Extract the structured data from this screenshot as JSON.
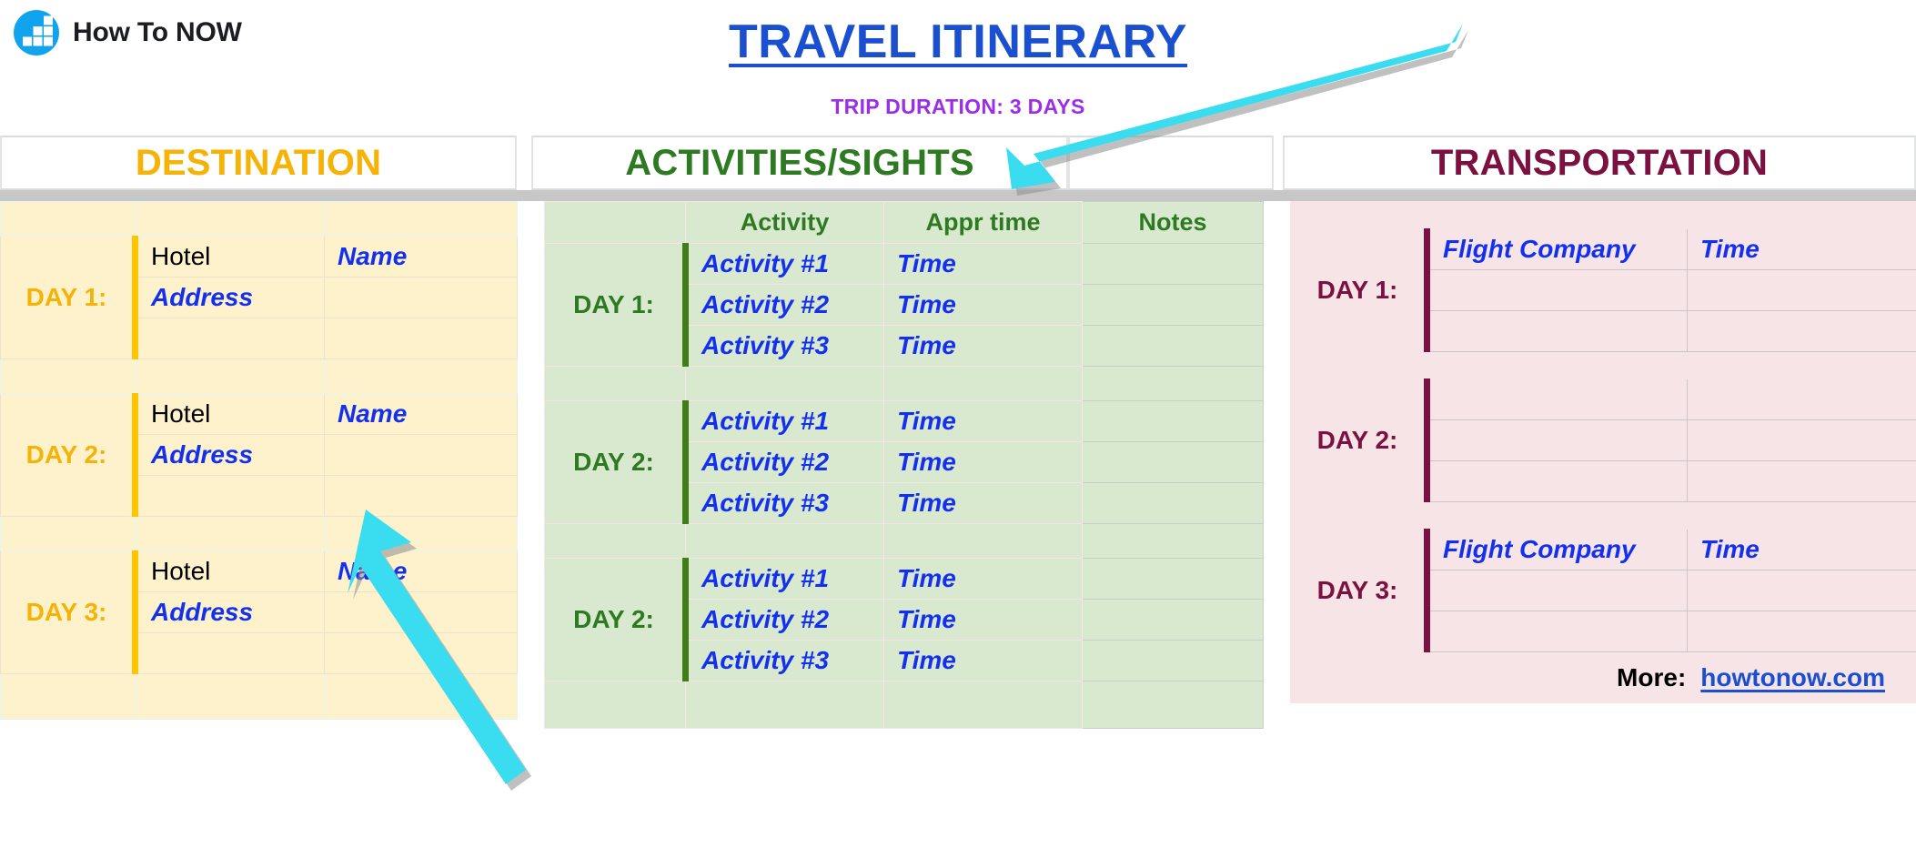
{
  "brand": {
    "name": "How To NOW",
    "logo_icon": "bar-chart-logo-icon",
    "logo_color": "#12a3ef"
  },
  "header": {
    "title": "TRAVEL ITINERARY",
    "title_color": "#1a4fd0",
    "subtitle": "TRIP DURATION: 3 DAYS",
    "subtitle_color": "#9b2ee6"
  },
  "sections": {
    "destination": {
      "caption": "DESTINATION",
      "accent": "#f5b207",
      "bg": "#fdf2cc",
      "days": [
        {
          "day_label": "DAY 1:",
          "hotel_label": "Hotel",
          "hotel_name": "Name",
          "address_label": "Address",
          "address_value": ""
        },
        {
          "day_label": "DAY 2:",
          "hotel_label": "Hotel",
          "hotel_name": "Name",
          "address_label": "Address",
          "address_value": ""
        },
        {
          "day_label": "DAY 3:",
          "hotel_label": "Hotel",
          "hotel_name": "Name",
          "address_label": "Address",
          "address_value": ""
        }
      ]
    },
    "activities": {
      "caption": "ACTIVITIES/SIGHTS",
      "accent": "#2e7a22",
      "bg": "#d9e9cf",
      "columns": [
        "",
        "Activity",
        "Appr time",
        "Notes"
      ],
      "days": [
        {
          "day_label": "DAY 1:",
          "rows": [
            {
              "activity": "Activity #1",
              "time": "Time",
              "notes": ""
            },
            {
              "activity": "Activity #2",
              "time": "Time",
              "notes": ""
            },
            {
              "activity": "Activity #3",
              "time": "Time",
              "notes": ""
            }
          ]
        },
        {
          "day_label": "DAY 2:",
          "rows": [
            {
              "activity": "Activity #1",
              "time": "Time",
              "notes": ""
            },
            {
              "activity": "Activity #2",
              "time": "Time",
              "notes": ""
            },
            {
              "activity": "Activity #3",
              "time": "Time",
              "notes": ""
            }
          ]
        },
        {
          "day_label": "DAY 2:",
          "rows": [
            {
              "activity": "Activity #1",
              "time": "Time",
              "notes": ""
            },
            {
              "activity": "Activity #2",
              "time": "Time",
              "notes": ""
            },
            {
              "activity": "Activity #3",
              "time": "Time",
              "notes": ""
            }
          ]
        }
      ]
    },
    "transportation": {
      "caption": "TRANSPORTATION",
      "accent": "#7a1141",
      "bg": "#f6e4e6",
      "days": [
        {
          "day_label": "DAY 1:",
          "company": "Flight Company",
          "time": "Time"
        },
        {
          "day_label": "DAY 2:",
          "company": "",
          "time": ""
        },
        {
          "day_label": "DAY 3:",
          "company": "Flight Company",
          "time": "Time"
        }
      ]
    }
  },
  "footer": {
    "more_label": "More:",
    "link_text": "howtonow.com",
    "link_color": "#1a4fd0"
  },
  "annotations": {
    "arrow_color": "#3adcf0",
    "arrows": [
      {
        "name": "arrow-to-activities-header",
        "points_to": "ACTIVITIES/SIGHTS"
      },
      {
        "name": "arrow-to-destination-name",
        "points_to": "Name"
      }
    ]
  }
}
